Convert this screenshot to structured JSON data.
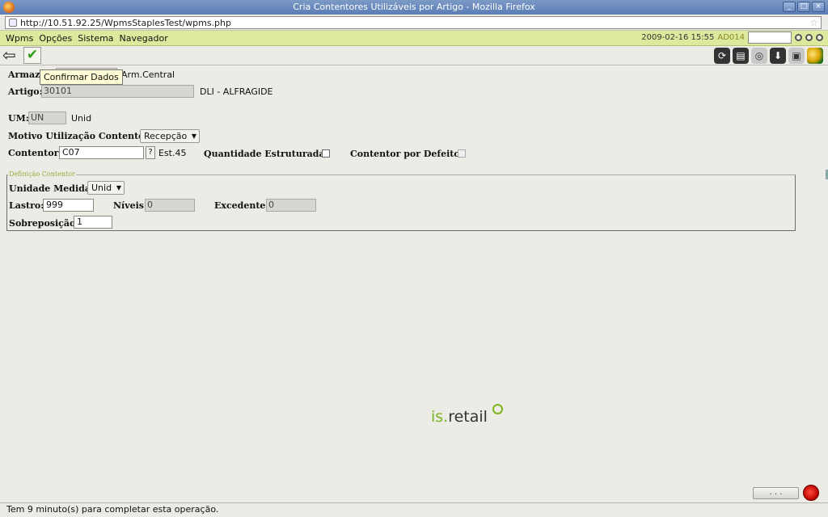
{
  "window": {
    "title": "Cria Contentores Utilizáveis por Artigo - Mozilla Firefox",
    "buttons": [
      "_",
      "□",
      "×"
    ]
  },
  "browser": {
    "url": "http://10.51.92.25/WpmsStaplesTest/wpms.php"
  },
  "menubar": {
    "items": [
      "Wpms",
      "Opções",
      "Sistema",
      "Navegador"
    ],
    "datetime": "2009-02-16 15:55",
    "user": "AD014"
  },
  "toolbar": {
    "back_icon": "back-arrow-icon",
    "confirm_tooltip": "Confirmar Dados",
    "right_icons": [
      "refresh-icon",
      "print-icon",
      "lifebuoy-icon",
      "download-icon",
      "package-icon",
      "app-logo-icon"
    ]
  },
  "form": {
    "armazem_label": "Armaz",
    "armazem_desc": "Arm.Central",
    "artigo_label": "Artigo:",
    "artigo_value": "30101",
    "artigo_desc": "DLI - ALFRAGIDE",
    "um_label": "UM:",
    "um_value": "UN",
    "um_desc": "Unid",
    "motivo_label": "Motivo Utilização Contentor:",
    "motivo_value": "Recepção",
    "contentor_label": "Contentor:",
    "contentor_value": "C07",
    "contentor_help": "?",
    "contentor_desc": "Est.45",
    "qtd_estruturada_label": "Quantidade Estruturada:",
    "contentor_defeito_label": "Contentor por Defeito:"
  },
  "definicao": {
    "legend": "Definição Contentor",
    "unidade_label": "Unidade Medida:",
    "unidade_value": "Unid",
    "lastro_label": "Lastro:",
    "lastro_value": "999",
    "niveis_label": "Níveis:",
    "niveis_value": "0",
    "excedente_label": "Excedente:",
    "excedente_value": "0",
    "sobreposicao_label": "Sobreposição:",
    "sobreposicao_value": "1"
  },
  "brand": {
    "prefix": "is.",
    "name": "retail",
    "accent_color": "#7ab51d"
  },
  "footer": {
    "progress_label": ". . .",
    "status": "Tem 9 minuto(s) para completar esta operação."
  }
}
